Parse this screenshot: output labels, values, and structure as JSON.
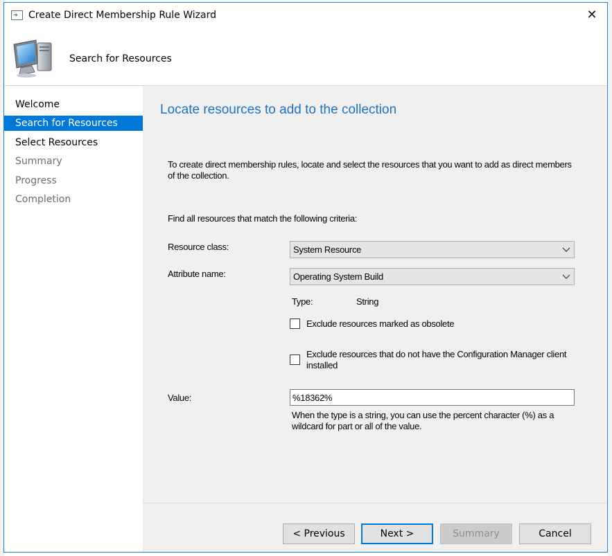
{
  "window": {
    "title": "Create Direct Membership Rule Wizard",
    "close_glyph": "✕"
  },
  "header": {
    "title": "Search for Resources",
    "icon": "computer-icon"
  },
  "sidebar": {
    "items": [
      {
        "label": "Welcome",
        "state": "done"
      },
      {
        "label": "Search for Resources",
        "state": "active"
      },
      {
        "label": "Select Resources",
        "state": "done"
      },
      {
        "label": "Summary",
        "state": "pending"
      },
      {
        "label": "Progress",
        "state": "pending"
      },
      {
        "label": "Completion",
        "state": "pending"
      }
    ]
  },
  "main": {
    "heading": "Locate resources to add to the collection",
    "intro": "To create direct membership rules, locate and select the resources that you want to add as direct members of the collection.",
    "criteria_label": "Find all resources that match the following criteria:",
    "resource_class": {
      "label": "Resource class:",
      "value": "System Resource"
    },
    "attribute_name": {
      "label": "Attribute name:",
      "value": "Operating System Build"
    },
    "type": {
      "label": "Type:",
      "value": "String"
    },
    "exclude_obsolete": {
      "label": "Exclude resources marked as obsolete",
      "checked": false
    },
    "exclude_no_client": {
      "label": "Exclude resources that do not have the Configuration Manager client installed",
      "checked": false
    },
    "value": {
      "label": "Value:",
      "value": "%18362%"
    },
    "hint": "When the type is a string, you can use the percent character (%) as a wildcard for part or all of the value."
  },
  "footer": {
    "previous_label": "< Previous",
    "next_label": "Next >",
    "summary_label": "Summary",
    "cancel_label": "Cancel"
  },
  "colors": {
    "accent": "#0078d7",
    "heading": "#1e73be",
    "content_bg": "#f0f0f0",
    "window_border": "#1883d7"
  }
}
